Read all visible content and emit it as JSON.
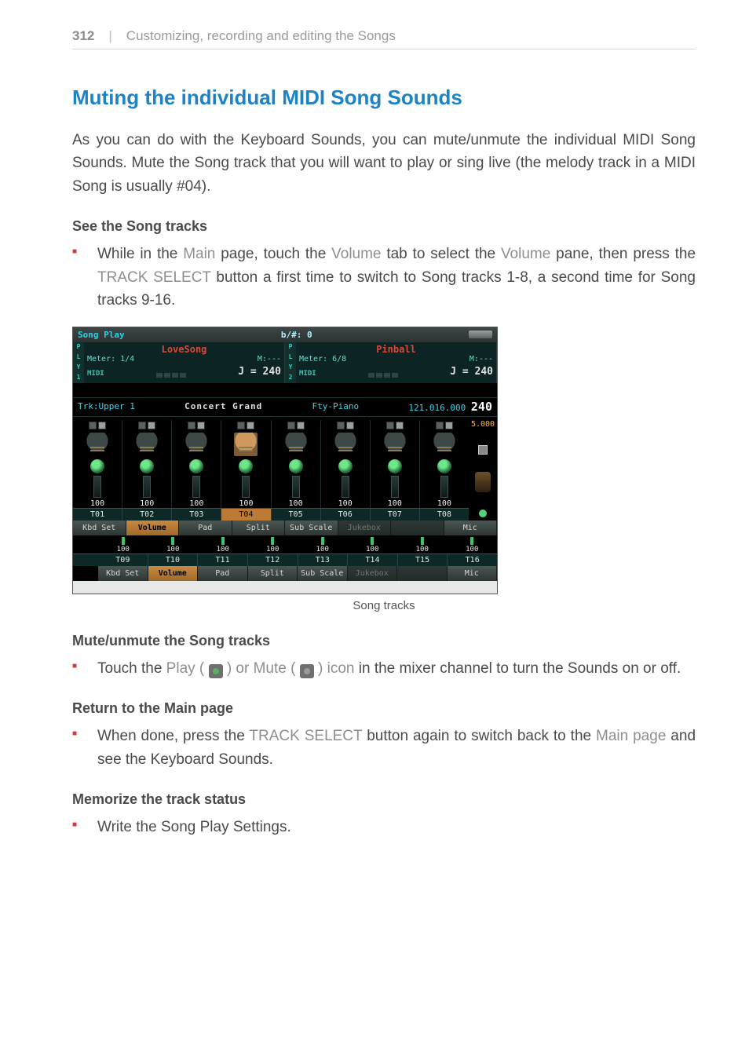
{
  "header": {
    "page_number": "312",
    "divider": "|",
    "chapter_title": "Customizing, recording and editing the Songs"
  },
  "section_title": "Muting the individual MIDI Song Sounds",
  "intro_paragraph": "As you can do with the Keyboard Sounds, you can mute/unmute the individual MIDI Song Sounds. Mute the Song track that you will want to play or sing live (the melody track in a MIDI Song is usually #04).",
  "subheads": {
    "see_tracks": "See the Song tracks",
    "mute_unmute": "Mute/unmute the Song tracks",
    "return_main": "Return to the Main page",
    "memorize": "Memorize the track status"
  },
  "bullets": {
    "see_tracks": {
      "pre": "While in the ",
      "main": "Main",
      "mid1": " page, touch the ",
      "volume": "Volume",
      "mid2": " tab to select the ",
      "volume2": "Volume",
      "mid3": " pane, then press the ",
      "track_select": "TRACK SELECT",
      "tail": " button a first time to switch to Song tracks 1-8, a second time for Song tracks 9-16."
    },
    "mute_unmute": {
      "pre": "Touch the ",
      "play": "Play (",
      "mid1": ") or ",
      "mute": "Mute (",
      "mid2": ") icon",
      "tail": " in the mixer channel to turn the Sounds on or off."
    },
    "return_main": {
      "pre": "When done, press the ",
      "track_select": "TRACK SELECT",
      "mid": " button again to switch back to the ",
      "main_page": "Main page",
      "tail": " and see the Keyboard Sounds."
    },
    "memorize": "Write the Song Play Settings."
  },
  "screenshot": {
    "titlebar": {
      "mode": "Song Play",
      "counter": "b/#: 0"
    },
    "ply": [
      "P",
      "L",
      "Y",
      "1"
    ],
    "ply2": [
      "P",
      "L",
      "Y",
      "2"
    ],
    "songs": [
      {
        "name": "LoveSong",
        "meter": "Meter: 1/4",
        "measure": "M:---",
        "midi": "MIDI",
        "tempo": "J = 240"
      },
      {
        "name": "Pinball",
        "meter": "Meter: 6/8",
        "measure": "M:---",
        "midi": "MIDI",
        "tempo": "J = 240"
      }
    ],
    "trk_info": {
      "track": "Trk:Upper 1",
      "instrument": "Concert Grand",
      "category": "Fty-Piano",
      "program": "121.016.000",
      "bpm": "240"
    },
    "right_rail": {
      "val1": "5.000"
    },
    "tracks_top": [
      {
        "label": "T01",
        "level": "100"
      },
      {
        "label": "T02",
        "level": "100"
      },
      {
        "label": "T03",
        "level": "100"
      },
      {
        "label": "T04",
        "level": "100",
        "selected": true
      },
      {
        "label": "T05",
        "level": "100"
      },
      {
        "label": "T06",
        "level": "100"
      },
      {
        "label": "T07",
        "level": "100"
      },
      {
        "label": "T08",
        "level": "100"
      }
    ],
    "tracks_bottom": [
      {
        "label": "T09",
        "level": "100"
      },
      {
        "label": "T10",
        "level": "100"
      },
      {
        "label": "T11",
        "level": "100"
      },
      {
        "label": "T12",
        "level": "100"
      },
      {
        "label": "T13",
        "level": "100"
      },
      {
        "label": "T14",
        "level": "100"
      },
      {
        "label": "T15",
        "level": "100"
      },
      {
        "label": "T16",
        "level": "100"
      }
    ],
    "tab_row1": [
      "Kbd Set",
      "Volume",
      "Pad",
      "Split",
      "Sub Scale",
      "Jukebox",
      "",
      "Mic"
    ],
    "tab_row2": [
      "Kbd Set",
      "Volume",
      "Pad",
      "Split",
      "Sub Scale",
      "Jukebox",
      "",
      "Mic"
    ],
    "selected_tab_index": 1
  },
  "caption": "Song tracks"
}
